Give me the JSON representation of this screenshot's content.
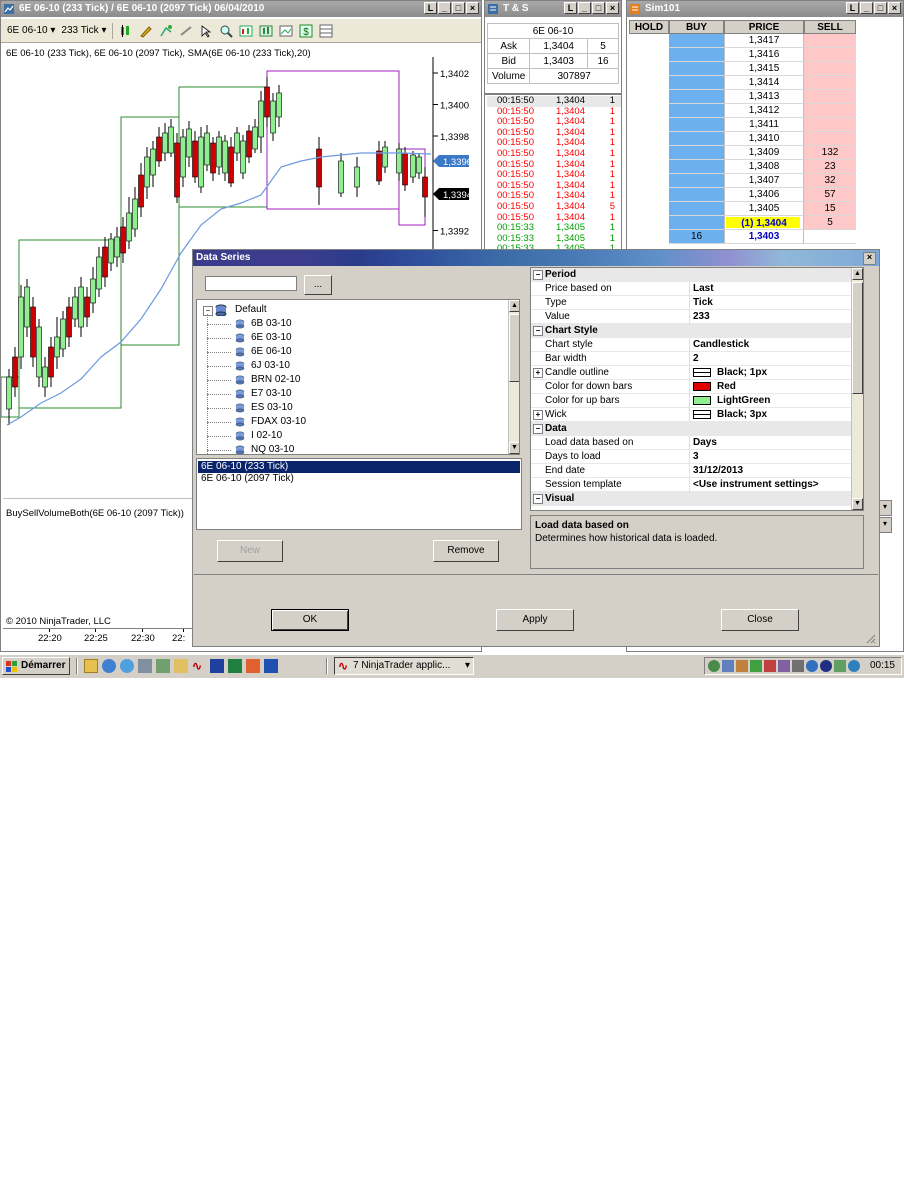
{
  "chart_window": {
    "title": "6E 06-10 (233 Tick) / 6E 06-10 (2097 Tick)  06/04/2010",
    "toolbar": {
      "instrument": "6E 06-10",
      "interval": "233 Tick"
    },
    "legend": "6E 06-10 (233 Tick), 6E 06-10 (2097 Tick), SMA(6E 06-10 (233 Tick),20)",
    "price_ticks": [
      "1,3402",
      "1,3400",
      "1,3398",
      "1,3396",
      "1,3394",
      "1,3392"
    ],
    "last_sma": "1,3396",
    "last_price": "1,3394",
    "indicator_label": "BuySellVolumeBoth(6E 06-10 (2097 Tick))",
    "copyright": "© 2010 NinjaTrader, LLC",
    "time_ticks": [
      "22:20",
      "22:25",
      "22:30",
      "22:"
    ]
  },
  "ts_window": {
    "title": "T & S",
    "instrument": "6E 06-10",
    "quotes": [
      {
        "label": "Ask",
        "price": "1,3404",
        "size": "5"
      },
      {
        "label": "Bid",
        "price": "1,3403",
        "size": "16"
      }
    ],
    "volume_label": "Volume",
    "volume": "307897",
    "tape": [
      {
        "time": "00:15:50",
        "price": "1,3404",
        "qty": "1",
        "side": "neutral"
      },
      {
        "time": "00:15:50",
        "price": "1,3404",
        "qty": "1",
        "side": "sell"
      },
      {
        "time": "00:15:50",
        "price": "1,3404",
        "qty": "1",
        "side": "sell"
      },
      {
        "time": "00:15:50",
        "price": "1,3404",
        "qty": "1",
        "side": "sell"
      },
      {
        "time": "00:15:50",
        "price": "1,3404",
        "qty": "1",
        "side": "sell"
      },
      {
        "time": "00:15:50",
        "price": "1,3404",
        "qty": "1",
        "side": "sell"
      },
      {
        "time": "00:15:50",
        "price": "1,3404",
        "qty": "1",
        "side": "sell"
      },
      {
        "time": "00:15:50",
        "price": "1,3404",
        "qty": "1",
        "side": "sell"
      },
      {
        "time": "00:15:50",
        "price": "1,3404",
        "qty": "1",
        "side": "sell"
      },
      {
        "time": "00:15:50",
        "price": "1,3404",
        "qty": "1",
        "side": "sell"
      },
      {
        "time": "00:15:50",
        "price": "1,3404",
        "qty": "5",
        "side": "sell"
      },
      {
        "time": "00:15:50",
        "price": "1,3404",
        "qty": "1",
        "side": "sell"
      },
      {
        "time": "00:15:33",
        "price": "1,3405",
        "qty": "1",
        "side": "buy"
      },
      {
        "time": "00:15:33",
        "price": "1,3405",
        "qty": "1",
        "side": "buy"
      },
      {
        "time": "00:15:33",
        "price": "1,3405",
        "qty": "1",
        "side": "buy"
      }
    ]
  },
  "dom_window": {
    "title": "Sim101",
    "headers": {
      "hold": "HOLD",
      "buy": "BUY",
      "price": "PRICE",
      "sell": "SELL"
    },
    "rows": [
      {
        "buy": "",
        "price": "1,3417",
        "sell": ""
      },
      {
        "buy": "",
        "price": "1,3416",
        "sell": ""
      },
      {
        "buy": "",
        "price": "1,3415",
        "sell": ""
      },
      {
        "buy": "",
        "price": "1,3414",
        "sell": ""
      },
      {
        "buy": "",
        "price": "1,3413",
        "sell": ""
      },
      {
        "buy": "",
        "price": "1,3412",
        "sell": ""
      },
      {
        "buy": "",
        "price": "1,3411",
        "sell": ""
      },
      {
        "buy": "",
        "price": "1,3410",
        "sell": ""
      },
      {
        "buy": "",
        "price": "1,3409",
        "sell": "132"
      },
      {
        "buy": "",
        "price": "1,3408",
        "sell": "23"
      },
      {
        "buy": "",
        "price": "1,3407",
        "sell": "32"
      },
      {
        "buy": "",
        "price": "1,3406",
        "sell": "57"
      },
      {
        "buy": "",
        "price": "1,3405",
        "sell": "15"
      },
      {
        "buy": "",
        "price": "(1) 1,3404",
        "sell": "5"
      },
      {
        "buy": "16",
        "price": "1,3403",
        "sell": ""
      }
    ]
  },
  "dialog": {
    "title": "Data Series",
    "search_button": "...",
    "tree_root": "Default",
    "instruments": [
      "6B 03-10",
      "6E 03-10",
      "6E 06-10",
      "6J 03-10",
      "BRN 02-10",
      "E7 03-10",
      "ES 03-10",
      "FDAX 03-10",
      "I 02-10",
      "NQ 03-10"
    ],
    "series_list": [
      "6E 06-10 (233 Tick)",
      "6E 06-10 (2097 Tick)"
    ],
    "new_button": "New",
    "remove_button": "Remove",
    "properties": [
      {
        "type": "category",
        "name": "Period"
      },
      {
        "type": "prop",
        "name": "Price based on",
        "value": "Last"
      },
      {
        "type": "prop",
        "name": "Type",
        "value": "Tick"
      },
      {
        "type": "prop",
        "name": "Value",
        "value": "233"
      },
      {
        "type": "category",
        "name": "Chart Style"
      },
      {
        "type": "prop",
        "name": "Chart style",
        "value": "Candlestick"
      },
      {
        "type": "prop",
        "name": "Bar width",
        "value": "2"
      },
      {
        "type": "prop",
        "name": "Candle outline",
        "value": "Black; 1px",
        "swatch": "outline",
        "expand": true
      },
      {
        "type": "prop",
        "name": "Color for down bars",
        "value": "Red",
        "swatch": "#e00000"
      },
      {
        "type": "prop",
        "name": "Color for up bars",
        "value": "LightGreen",
        "swatch": "#90ee90"
      },
      {
        "type": "prop",
        "name": "Wick",
        "value": "Black; 3px",
        "swatch": "outline",
        "expand": true
      },
      {
        "type": "category",
        "name": "Data"
      },
      {
        "type": "prop",
        "name": "Load data based on",
        "value": "Days"
      },
      {
        "type": "prop",
        "name": "Days to load",
        "value": "3"
      },
      {
        "type": "prop",
        "name": "End date",
        "value": "31/12/2013"
      },
      {
        "type": "prop",
        "name": "Session template",
        "value": "<Use instrument settings>"
      },
      {
        "type": "category",
        "name": "Visual"
      }
    ],
    "help_title": "Load data based on",
    "help_text": "Determines how historical data is loaded.",
    "ok_button": "OK",
    "apply_button": "Apply",
    "close_button": "Close"
  },
  "taskbar": {
    "start_label": "Démarrer",
    "task_label": "7 NinjaTrader applic...",
    "clock": "00:15"
  },
  "colors": {
    "up_bar": "#90ee90",
    "down_bar": "#cc0000",
    "box_green": "#2e8b2e",
    "box_purple": "#a020c0",
    "sma": "#6c9ae0",
    "buy_col": "#6cb0f0",
    "sell_col": "#ffc8c8",
    "ts_sell": "#ff0000",
    "ts_buy": "#00a000",
    "inside_price": "#ffff00"
  }
}
